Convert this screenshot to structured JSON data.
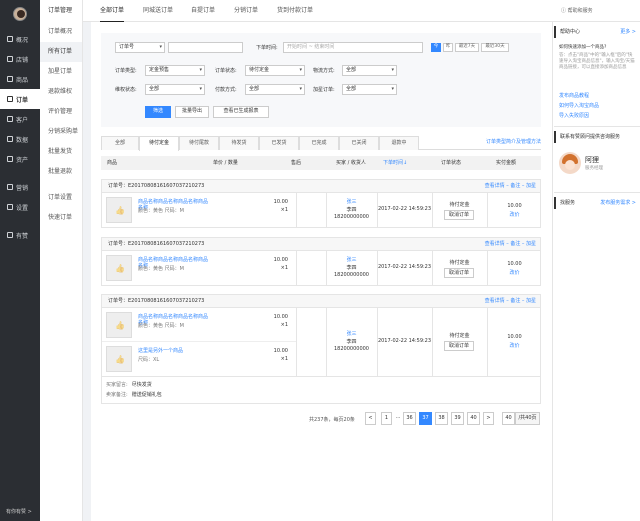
{
  "sidebar": {
    "items": [
      {
        "label": "概况"
      },
      {
        "label": "店铺"
      },
      {
        "label": "商品"
      },
      {
        "label": "订单"
      },
      {
        "label": "客户"
      },
      {
        "label": "数据"
      },
      {
        "label": "资产"
      },
      {
        "label": "营销"
      },
      {
        "label": "设置"
      },
      {
        "label": "有赞"
      }
    ],
    "bottom": "有你有赞 >"
  },
  "subnav": {
    "title": "订单管理",
    "items": [
      "订单概况",
      "所有订单",
      "加星订单",
      "退款维权",
      "评价管理",
      "分销采购单",
      "批量发货",
      "批量退款",
      "订单设置",
      "快速订单"
    ]
  },
  "topbar": {
    "tabs": [
      "全部订单",
      "同城送订单",
      "自提订单",
      "分销订单",
      "货到付款订单"
    ],
    "help": "帮助和服务"
  },
  "filter": {
    "order_no_select": "订单号",
    "order_no_value": "",
    "time_label": "下单时间:",
    "time_placeholder": "开始时间 ~ 结束时间",
    "quick_dates": [
      "今",
      "昨",
      "最近7天",
      "最近30天"
    ],
    "type_label": "订单类型:",
    "type_value": "定金预售",
    "status_label": "订单状态:",
    "status_value": "待付定金",
    "logistics_label": "物流方式:",
    "logistics_value": "全部",
    "rights_label": "维权状态:",
    "rights_value": "全部",
    "pay_label": "付款方式:",
    "pay_value": "全部",
    "star_label": "加星订单:",
    "star_value": "全部",
    "btn_filter": "筛选",
    "btn_export": "批量导出",
    "btn_report": "查看已生成报表"
  },
  "status_tabs": {
    "items": [
      "全部",
      "待付定金",
      "待付尾款",
      "待发货",
      "已发货",
      "已完成",
      "已关闭",
      "退款中"
    ],
    "help_link": "订单类型简介及管理方法"
  },
  "table_head": [
    "商品",
    "单价 / 数量",
    "售后",
    "买家 / 收货人",
    "下单时间↓",
    "订单状态",
    "实付金额"
  ],
  "orders": [
    {
      "order_label": "订单号：E20170808161607037210273",
      "ops": "查看详情 – 备注 – 加星",
      "items": [
        {
          "name": "商品名称商品名称商品名称商品名称",
          "spec": "颜色：黄色   尺码：M",
          "price": "10.00",
          "qty": "×1"
        }
      ],
      "buyer": "张三",
      "receiver": "李四",
      "phone": "18200000000",
      "time": "2017-02-22 14:59:23",
      "status": "待付定金",
      "action": "取消订单",
      "amount": "10.00",
      "change": "改价"
    },
    {
      "order_label": "订单号：E20170808161607037210273",
      "ops": "查看详情 – 备注 – 加星",
      "items": [
        {
          "name": "商品名称商品名称商品名称商品名称",
          "spec": "颜色：黄色   尺码：M",
          "price": "10.00",
          "qty": "×1"
        }
      ],
      "buyer": "张三",
      "receiver": "李四",
      "phone": "18200000000",
      "time": "2017-02-22 14:59:23",
      "status": "待付定金",
      "action": "取消订单",
      "amount": "10.00",
      "change": "改价"
    },
    {
      "order_label": "订单号：E20170808161607037210273",
      "ops": "查看详情 – 备注 – 加星",
      "items": [
        {
          "name": "商品名称商品名称商品名称商品名称",
          "spec": "颜色：黄色   尺码：M",
          "price": "10.00",
          "qty": "×1"
        },
        {
          "name": "这里是另外一个商品",
          "spec": "尺码：XL",
          "price": "10.00",
          "qty": "×1"
        }
      ],
      "buyer": "张三",
      "receiver": "李四",
      "phone": "18200000000",
      "time": "2017-02-22 14:59:23",
      "status": "待付定金",
      "action": "取消订单",
      "amount": "10.00",
      "change": "改价",
      "buyer_note_label": "买家留言:",
      "buyer_note": "尽快发货",
      "seller_note_label": "卖家备注:",
      "seller_note": "赠送促销礼包"
    }
  ],
  "pagination": {
    "summary": "共237条，每页20条",
    "prev": "<",
    "pages": [
      "1",
      "...",
      "36",
      "37",
      "38",
      "39",
      "40"
    ],
    "next": ">",
    "current": "37",
    "jump_value": "40",
    "total_pages": "/共40页"
  },
  "right_panel": {
    "help_title": "帮助中心",
    "help_more": "更多 >",
    "question": "如何快速添加一个商品?",
    "answer": "答：点击\"商品\"中的\"输入框\"后的\"快速导入淘宝商品信息\"，输入淘宝/天猫商品链接，可以直接添加商品信息",
    "links": [
      "发布商品教程",
      "如何导入淘宝商品",
      "导入失败原因"
    ],
    "contact_title": "联系有赞顾问提供咨询服务",
    "consultant_name": "阿狸",
    "consultant_role": "服务经理",
    "service_title": "找服务",
    "service_link": "发布服务需求 >"
  },
  "colors": {
    "accent": "#3388ff",
    "sidebar": "#2b2e33"
  }
}
